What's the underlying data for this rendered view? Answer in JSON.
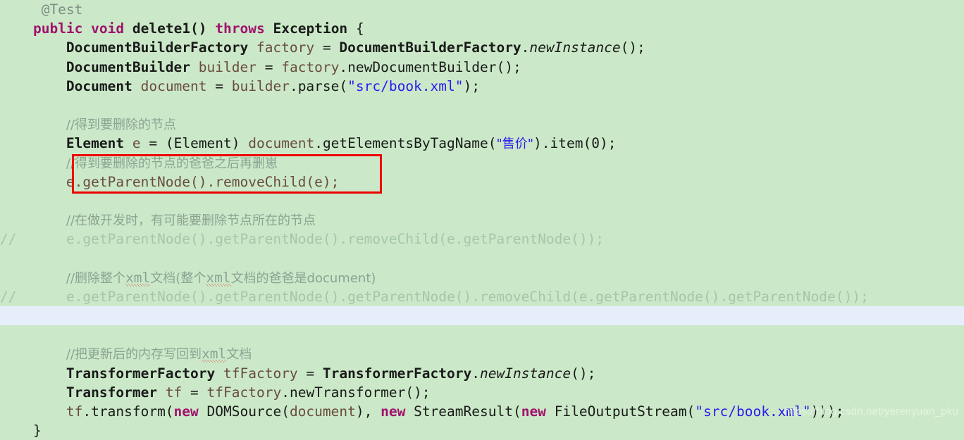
{
  "editor": {
    "background_color": "#cbe9c8",
    "highlight_line_color": "#e6eefb",
    "annotation_box_color": "#ee0000",
    "language": "Java"
  },
  "code": {
    "l01_annotation": "@Test",
    "l02_kw_public": "public",
    "l02_kw_void": "void",
    "l02_method": "delete1()",
    "l02_kw_throws": "throws",
    "l02_exception": "Exception",
    "l02_brace": "{",
    "l03_type": "DocumentBuilderFactory",
    "l03_var": "factory",
    "l03_eq": "=",
    "l03_class": "DocumentBuilderFactory",
    "l03_call": "newInstance",
    "l03_tail": "();",
    "l04_type": "DocumentBuilder",
    "l04_var": "builder",
    "l04_eq": "=",
    "l04_obj": "factory",
    "l04_call": ".newDocumentBuilder();",
    "l05_type": "Document",
    "l05_var": "document",
    "l05_eq": "=",
    "l05_obj": "builder",
    "l05_call": ".parse(",
    "l05_str": "\"src/book.xml\"",
    "l05_tail": ");",
    "l07_comment": "//得到要删除的节点",
    "l08_type": "Element",
    "l08_var": "e",
    "l08_eq": "=",
    "l08_cast": "(Element)",
    "l08_obj": "document",
    "l08_call": ".getElementsByTagName(",
    "l08_str": "\"售价\"",
    "l08_tail": ").item(0);",
    "l09_comment": "//得到要删除的节点的爸爸之后再删崽",
    "l10_code": "e.getParentNode().removeChild(e);",
    "l12_comment": "//在做开发时，有可能要删除节点所在的节点",
    "l13_prefix": "//",
    "l13_code": "e.getParentNode().getParentNode().removeChild(e.getParentNode());",
    "l15_comment_a": "//删除整个",
    "l15_comment_xml1": "xml",
    "l15_comment_b": "文档(整个",
    "l15_comment_xml2": "xml",
    "l15_comment_c": "文档的爸爸是document)",
    "l16_prefix": "//",
    "l16_code": "e.getParentNode().getParentNode().getParentNode().removeChild(e.getParentNode().getParentNode());",
    "l17_empty": "",
    "l19_comment_a": "//把更新后的内存写回到",
    "l19_comment_xml": "xml",
    "l19_comment_b": "文档",
    "l20_type": "TransformerFactory",
    "l20_var": "tfFactory",
    "l20_eq": "=",
    "l20_class": "TransformerFactory",
    "l20_call": "newInstance",
    "l20_tail": "();",
    "l21_type": "Transformer",
    "l21_var": "tf",
    "l21_eq": "=",
    "l21_obj": "tfFactory",
    "l21_call": ".newTransformer();",
    "l22_obj": "tf",
    "l22_call": ".transform(",
    "l22_new1": "new",
    "l22_cls1": "DOMSource(",
    "l22_arg1": "document",
    "l22_mid": "), ",
    "l22_new2": "new",
    "l22_cls2": "StreamResult(",
    "l22_new3": "new",
    "l22_cls3": "FileOutputStream(",
    "l22_str": "\"src/book.xml\"",
    "l22_tail": ")));",
    "l23_brace": "}"
  },
  "watermark": {
    "text": "https://blog.csdn.net/yerenyuan_pku"
  }
}
